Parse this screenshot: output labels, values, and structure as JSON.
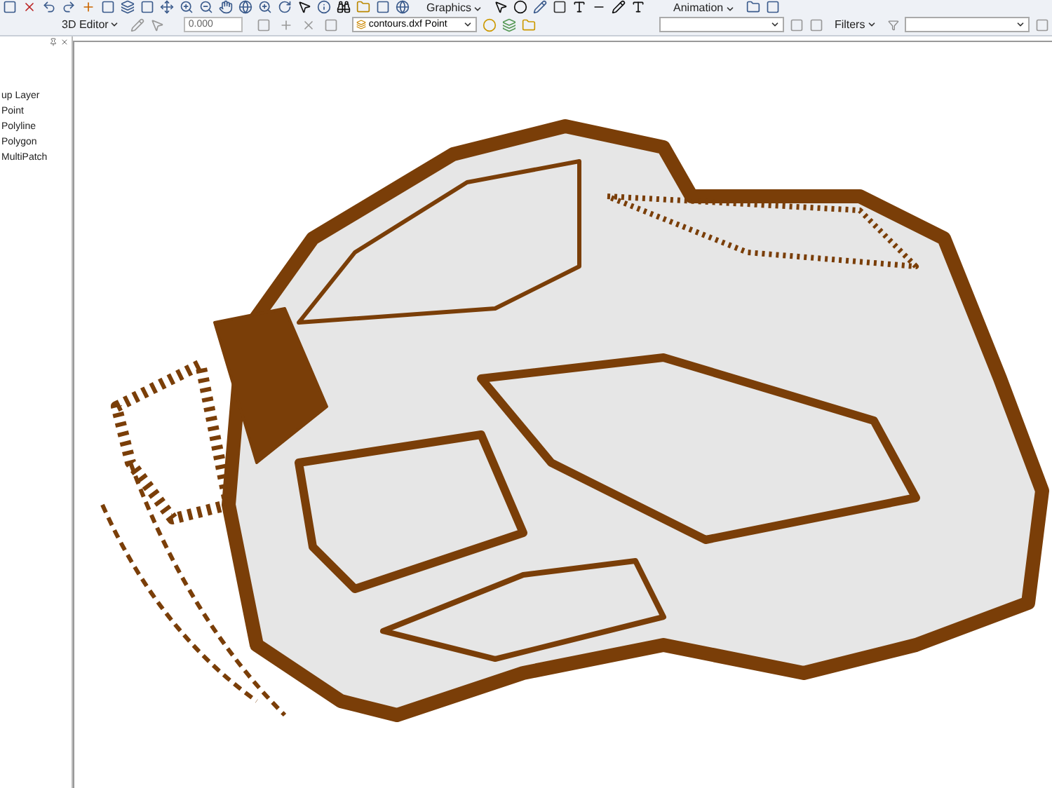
{
  "toolbar_top": {
    "menus": [
      {
        "label": "Graphics"
      },
      {
        "label": "Animation"
      }
    ]
  },
  "toolbar_3d": {
    "menu": "3D Editor",
    "offset_value": "0.000",
    "layer_dropdown": "contours.dxf Point",
    "filters_menu": "Filters"
  },
  "layers_panel": {
    "items": [
      {
        "label": "up Layer"
      },
      {
        "label": "Point"
      },
      {
        "label": "Polyline"
      },
      {
        "label": "Polygon"
      },
      {
        "label": "MultiPatch"
      }
    ]
  }
}
